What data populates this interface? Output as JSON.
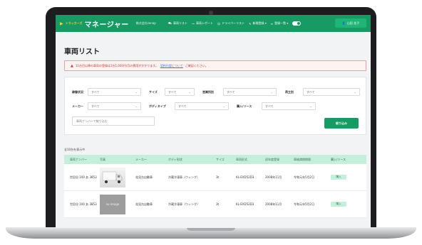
{
  "header": {
    "brand_small": "トラッカーズ",
    "brand_name": "マネージャー",
    "company": "株式会社zenap",
    "nav": [
      {
        "icon": "truck-icon",
        "glyph": "⛟",
        "label": "車両リスト"
      },
      {
        "icon": "chart-line-icon",
        "glyph": "⁓",
        "label": "車両レポート"
      },
      {
        "icon": "people-icon",
        "glyph": "☺",
        "label": "ドライバーリスト"
      },
      {
        "icon": "pencil-icon",
        "glyph": "✎",
        "label": "新規登録 ▾"
      },
      {
        "icon": "list-icon",
        "glyph": "≡",
        "label": "登録一覧 ▾"
      }
    ],
    "user": "山田 花子"
  },
  "page": {
    "title": "車両リスト",
    "alert": {
      "text": "11台目以降の車両の登録は1台1,000円/月の費用がかかります。",
      "link": "契約内容について",
      "suffix": "ご確認ください。"
    }
  },
  "filters": {
    "labels": {
      "status": "稼働状況",
      "size": "サイズ",
      "office": "営業所別",
      "vehicle_type": "荷主別",
      "maker": "メーカー",
      "body_type": "ボディタイプ",
      "purchase": "購入/リース"
    },
    "all": "すべて",
    "search_placeholder": "車両ナンバーで絞り込む",
    "submit": "絞り込み"
  },
  "list": {
    "count": "全10台を表示中",
    "columns": [
      "車両ナンバー",
      "写真",
      "メーカー",
      "ボディ形状",
      "サイズ",
      "車両形式",
      "初年度登録",
      "車検満期期限",
      "購入/リース"
    ],
    "rows": [
      {
        "plate": "世田谷 100 あ 3853",
        "photo": "",
        "maker": "花見台自動車",
        "body": "冷蔵冷凍車（ウィング）",
        "size": "3t",
        "model": "KL-EXD52D3",
        "first_reg": "2008年11月",
        "inspection": "令和元年5月2日",
        "lease": "購入"
      },
      {
        "plate": "世田谷 100 あ 3853",
        "photo": "no image",
        "maker": "花見台自動車",
        "body": "冷蔵冷凍車（ウィング）",
        "size": "3t",
        "model": "KL-EXD52D3",
        "first_reg": "2008年11月",
        "inspection": "令和元年5月2日",
        "lease": "購入"
      }
    ]
  }
}
